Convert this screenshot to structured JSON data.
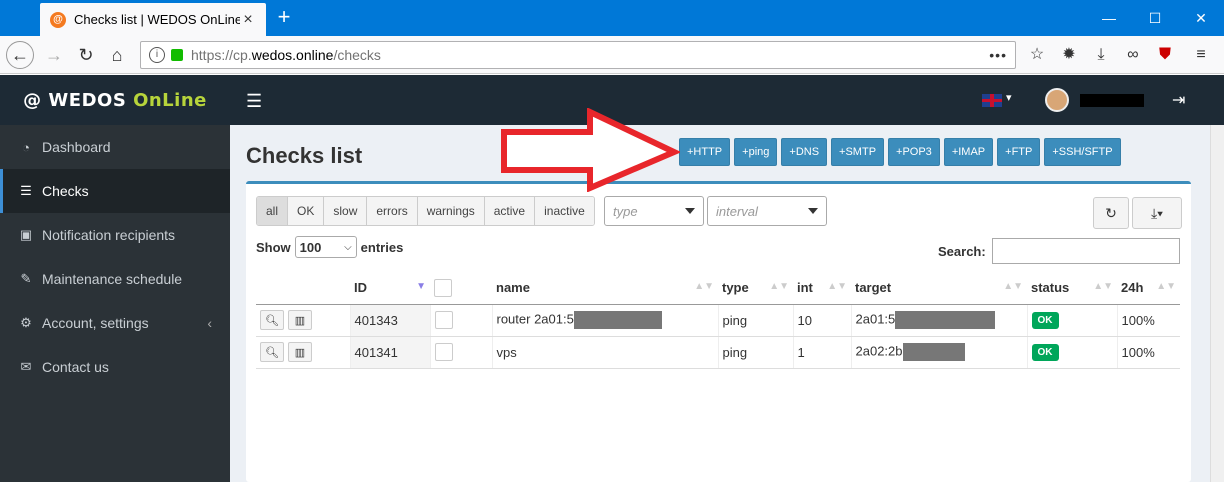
{
  "browser": {
    "tab_title": "Checks list | WEDOS OnLine",
    "favicon": "@",
    "url_prefix": "https://cp.",
    "url_domain": "wedos.online",
    "url_path": "/checks",
    "more_dots": "•••"
  },
  "app": {
    "logo_main": "WEDOS",
    "logo_accent": "OnLine"
  },
  "sidebar": {
    "items": [
      {
        "label": "Dashboard",
        "icon": "dashboard-icon"
      },
      {
        "label": "Checks",
        "icon": "list-icon"
      },
      {
        "label": "Notification recipients",
        "icon": "contact-card-icon"
      },
      {
        "label": "Maintenance schedule",
        "icon": "wrench-icon"
      },
      {
        "label": "Account, settings",
        "icon": "gears-icon"
      },
      {
        "label": "Contact us",
        "icon": "envelope-icon"
      }
    ]
  },
  "page": {
    "title": "Checks list",
    "add_buttons": [
      "+HTTP",
      "+ping",
      "+DNS",
      "+SMTP",
      "+POP3",
      "+IMAP",
      "+FTP",
      "+SSH/SFTP"
    ]
  },
  "filters": {
    "buttons": [
      "all",
      "OK",
      "slow",
      "errors",
      "warnings",
      "active",
      "inactive"
    ],
    "active": "all",
    "type_placeholder": "type",
    "interval_placeholder": "interval"
  },
  "table_controls": {
    "show_label": "Show",
    "show_value": "100",
    "entries_label": "entries",
    "search_label": "Search:"
  },
  "table": {
    "headers": [
      "",
      "ID",
      "",
      "name",
      "type",
      "int",
      "target",
      "status",
      "24h"
    ],
    "rows": [
      {
        "id": "401343",
        "name": "router 2a01:5",
        "type": "ping",
        "int": "10",
        "target": "2a01:5",
        "status": "OK",
        "uptime": "100%"
      },
      {
        "id": "401341",
        "name": "vps",
        "type": "ping",
        "int": "1",
        "target": "2a02:2b",
        "status": "OK",
        "uptime": "100%"
      }
    ]
  },
  "colors": {
    "primary": "#3c8dbc",
    "ok": "#00a65a",
    "annotation_arrow": "#e8262b"
  }
}
